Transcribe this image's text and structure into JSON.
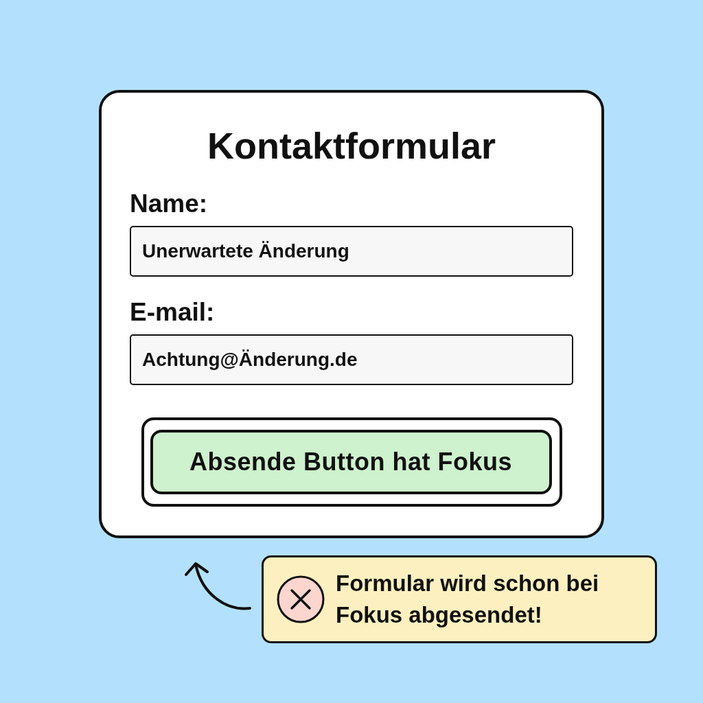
{
  "form": {
    "title": "Kontaktformular",
    "fields": [
      {
        "label": "Name:",
        "value": "Unerwartete Änderung"
      },
      {
        "label": "E-mail:",
        "value": "Achtung@Änderung.de"
      }
    ],
    "submit_button": {
      "label": "Absende Button hat Fokus",
      "focused": true
    }
  },
  "callout": {
    "kind": "error",
    "message": "Formular wird schon bei Fokus abgesendet!"
  }
}
